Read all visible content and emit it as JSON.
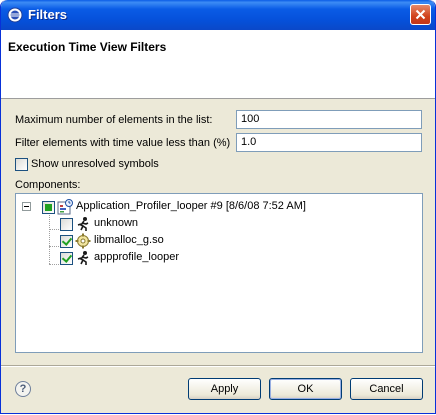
{
  "window": {
    "title": "Filters",
    "header_title": "Execution Time View Filters"
  },
  "form": {
    "max_elements_label": "Maximum number of elements in the list:",
    "max_elements_value": "100",
    "time_filter_label": "Filter elements with time value less than (%)",
    "time_filter_value": "1.0",
    "show_unresolved_label": "Show unresolved symbols",
    "show_unresolved_checked": false,
    "components_label": "Components:"
  },
  "tree": {
    "root": {
      "label": "Application_Profiler_looper #9 [8/6/08 7:52 AM]",
      "state": "partial",
      "icon": "profiler-session-icon"
    },
    "children": [
      {
        "label": "unknown",
        "checked": false,
        "icon": "runner-icon"
      },
      {
        "label": "libmalloc_g.so",
        "checked": true,
        "icon": "gear-icon"
      },
      {
        "label": "appprofile_looper",
        "checked": true,
        "icon": "runner-icon"
      }
    ]
  },
  "buttons": {
    "apply": "Apply",
    "ok": "OK",
    "cancel": "Cancel",
    "help_glyph": "?"
  },
  "colors": {
    "titlebar": "#0a5ce6",
    "dialog_bg": "#ece9d8",
    "input_border": "#7f9db9",
    "check_green": "#21a121"
  }
}
